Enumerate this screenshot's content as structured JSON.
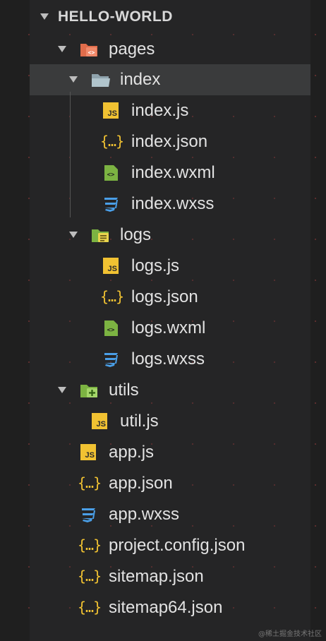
{
  "explorer": {
    "root": "HELLO-WORLD",
    "pages": {
      "label": "pages",
      "index": {
        "label": "index",
        "files": [
          "index.js",
          "index.json",
          "index.wxml",
          "index.wxss"
        ]
      },
      "logs": {
        "label": "logs",
        "files": [
          "logs.js",
          "logs.json",
          "logs.wxml",
          "logs.wxss"
        ]
      }
    },
    "utils": {
      "label": "utils",
      "files": [
        "util.js"
      ]
    },
    "root_files": [
      "app.js",
      "app.json",
      "app.wxss",
      "project.config.json",
      "sitemap.json",
      "sitemap64.json"
    ]
  },
  "watermark": "@稀土掘金技术社区",
  "colors": {
    "js": "#f1c232",
    "json": "#f1c232",
    "wxml": "#7cb342",
    "wxss": "#4a9fe8",
    "folder_pages": "#e06c4b",
    "folder_index": "#8fa3ad",
    "folder_logs": "#7cb342",
    "folder_utils": "#7cb342",
    "selected_row": "#3a3b3c"
  }
}
